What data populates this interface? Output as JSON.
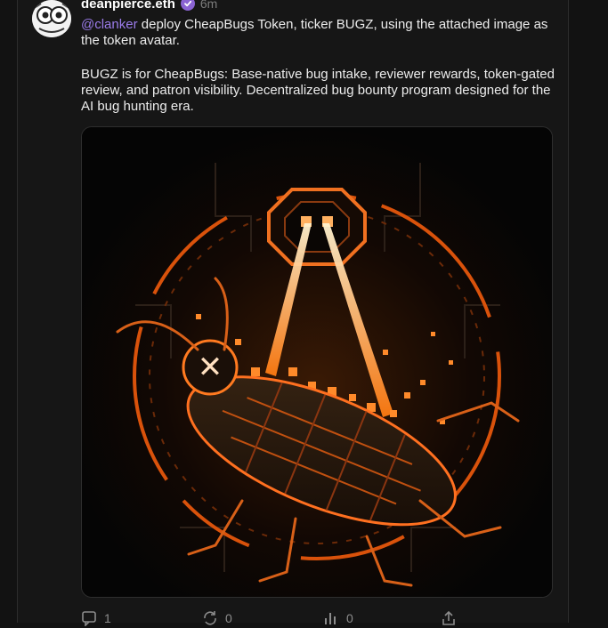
{
  "post": {
    "author": {
      "display_name": "deanpierce.eth",
      "verified": true
    },
    "timestamp": "6m",
    "mention": "@clanker",
    "text_line1": " deploy CheapBugs Token, ticker BUGZ, using the attached image as the token avatar.",
    "text_para2": "BUGZ is for CheapBugs: Base-native bug intake, reviewer rewards, token-gated review, and patron visibility. Decentralized bug bounty program designed for the AI bug hunting era.",
    "image": {
      "glyph": "✕"
    },
    "actions": {
      "replies": {
        "icon": "comment-icon",
        "count": "1"
      },
      "recasts": {
        "icon": "recast-icon",
        "count": "0"
      },
      "likes": {
        "icon": "like-icon",
        "count": "0"
      },
      "share": {
        "icon": "share-icon"
      }
    }
  },
  "colors": {
    "background": "#121212",
    "accent": "#8a63d2",
    "mention": "#9b7bea",
    "laser": "#ff8a1e"
  }
}
